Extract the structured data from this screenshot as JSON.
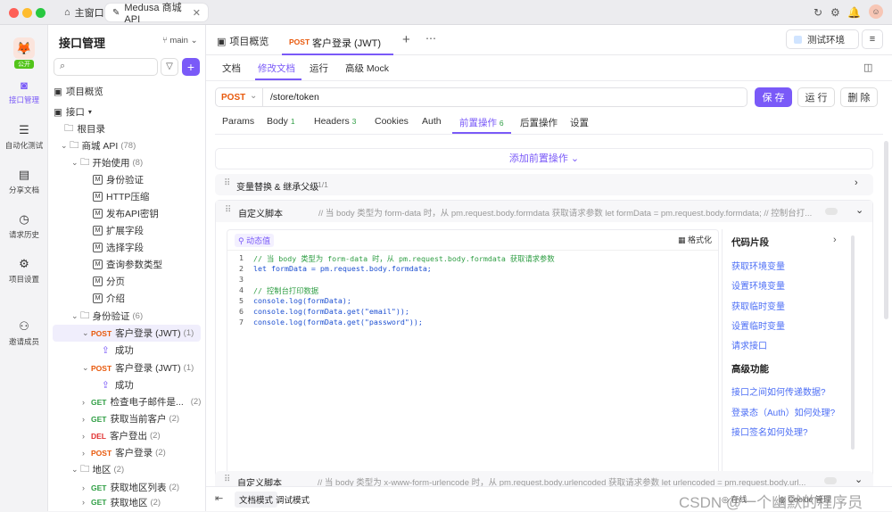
{
  "titlebar": {
    "tabs": [
      {
        "label": "主窗口"
      },
      {
        "label": "Medusa 商城 API"
      }
    ]
  },
  "rail": [
    {
      "label": "公开"
    },
    {
      "label": "接口管理"
    },
    {
      "label": "自动化测试"
    },
    {
      "label": "分享文档"
    },
    {
      "label": "请求历史"
    },
    {
      "label": "项目设置"
    },
    {
      "label": "邀请成员"
    }
  ],
  "sidebar": {
    "title": "接口管理",
    "branch": "main",
    "overview": "项目概览",
    "api_root": "接口",
    "root_dir": "根目录",
    "items": [
      {
        "label": "商城 API",
        "count": "(78)"
      },
      {
        "label": "开始使用",
        "count": "(8)"
      },
      {
        "label": "身份验证"
      },
      {
        "label": "HTTP压缩"
      },
      {
        "label": "发布API密钥"
      },
      {
        "label": "扩展字段"
      },
      {
        "label": "选择字段"
      },
      {
        "label": "查询参数类型"
      },
      {
        "label": "分页"
      },
      {
        "label": "介绍"
      },
      {
        "label": "身份验证",
        "count": "(6)"
      },
      {
        "method": "POST",
        "label": "客户登录 (JWT)",
        "count": "(1)"
      },
      {
        "label": "成功"
      },
      {
        "method": "POST",
        "label": "客户登录 (JWT)",
        "count": "(1)"
      },
      {
        "label": "成功"
      },
      {
        "method": "GET",
        "label": "检查电子邮件是...",
        "count": "(2)"
      },
      {
        "method": "GET",
        "label": "获取当前客户",
        "count": "(2)"
      },
      {
        "method": "DEL",
        "label": "客户登出",
        "count": "(2)"
      },
      {
        "method": "POST",
        "label": "客户登录",
        "count": "(2)"
      },
      {
        "label": "地区",
        "count": "(2)"
      },
      {
        "method": "GET",
        "label": "获取地区列表",
        "count": "(2)"
      },
      {
        "method": "GET",
        "label": "获取地区",
        "count": "(2)"
      }
    ]
  },
  "main": {
    "tab_overview": "项目概览",
    "tab_active_method": "POST",
    "tab_active_label": "客户登录 (JWT)",
    "env": "测试环境",
    "mode_tabs": [
      "文档",
      "修改文档",
      "运行",
      "高级 Mock"
    ],
    "method": "POST",
    "url": "/store/token",
    "save": "保 存",
    "run": "运 行",
    "delete": "删 除",
    "req_tabs": [
      {
        "label": "Params"
      },
      {
        "label": "Body",
        "badge": "1"
      },
      {
        "label": "Headers",
        "badge": "3"
      },
      {
        "label": "Cookies"
      },
      {
        "label": "Auth"
      },
      {
        "label": "前置操作",
        "badge": "6"
      },
      {
        "label": "后置操作"
      },
      {
        "label": "设置"
      }
    ],
    "add_pre": "添加前置操作",
    "var_replace": "变量替换 & 继承父级",
    "var_count": "1/1",
    "script1_title": "自定义脚本",
    "script1_comment": "// 当 body 类型为 form-data 时，从 pm.request.body.formdata 获取请求参数 let formData = pm.request.body.formdata; // 控制台打...",
    "dynamic_value": "动态值",
    "format": "格式化",
    "code": [
      "// 当 body 类型为 form-data 时，从 pm.request.body.formdata 获取请求参数",
      "let formData = pm.request.body.formdata;",
      "",
      "// 控制台打印数据",
      "console.log(formData);",
      "console.log(formData.get(\"email\"));",
      "console.log(formData.get(\"password\"));"
    ],
    "snippets_title": "代码片段",
    "snippets": [
      "获取环境变量",
      "设置环境变量",
      "获取临时变量",
      "设置临时变量",
      "请求接口"
    ],
    "advanced_title": "高级功能",
    "advanced": [
      "接口之间如何传递数据?",
      "登录态（Auth）如何处理?",
      "接口签名如何处理?"
    ],
    "script2_title": "自定义脚本",
    "script2_comment": "// 当 body 类型为 x-www-form-urlencode 时，从 pm.request.body.urlencoded 获取请求参数 let urlencoded = pm.request.body.url...",
    "bottom_doc": "文档模式",
    "bottom_debug": "调试模式",
    "watermark": "CSDN @一个幽默的程序员",
    "bottom_right": [
      "在线",
      "Cookie",
      "管理"
    ]
  }
}
